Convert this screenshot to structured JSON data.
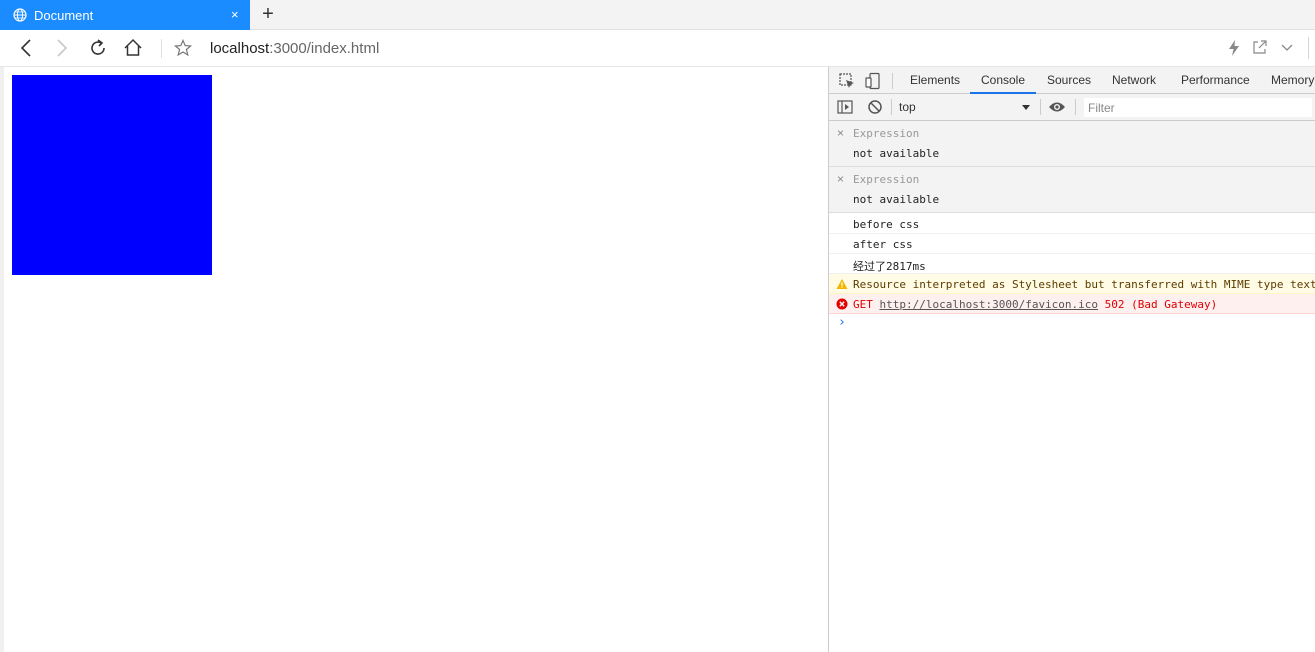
{
  "browser": {
    "tab_title": "Document",
    "close_glyph": "×",
    "new_tab_glyph": "+",
    "url_host": "localhost",
    "url_path": ":3000/index.html",
    "accent": "#1a8cff"
  },
  "page": {
    "box_color": "#0000ff"
  },
  "devtools": {
    "tabs": [
      "Elements",
      "Console",
      "Sources",
      "Network",
      "Performance",
      "Memory"
    ],
    "active_tab": "Console",
    "context": "top",
    "filter_placeholder": "Filter",
    "expressions": [
      {
        "label": "Expression",
        "value": "not available"
      },
      {
        "label": "Expression",
        "value": "not available"
      }
    ],
    "logs": [
      {
        "level": "log",
        "text": "before css"
      },
      {
        "level": "log",
        "text": "after css"
      },
      {
        "level": "log",
        "text": "经过了2817ms"
      }
    ],
    "warning": {
      "text": "Resource interpreted as Stylesheet but transferred with MIME type text"
    },
    "error": {
      "method": "GET",
      "url": "http://localhost:3000/favicon.ico",
      "status": "502 (Bad Gateway)"
    },
    "prompt": "›"
  }
}
